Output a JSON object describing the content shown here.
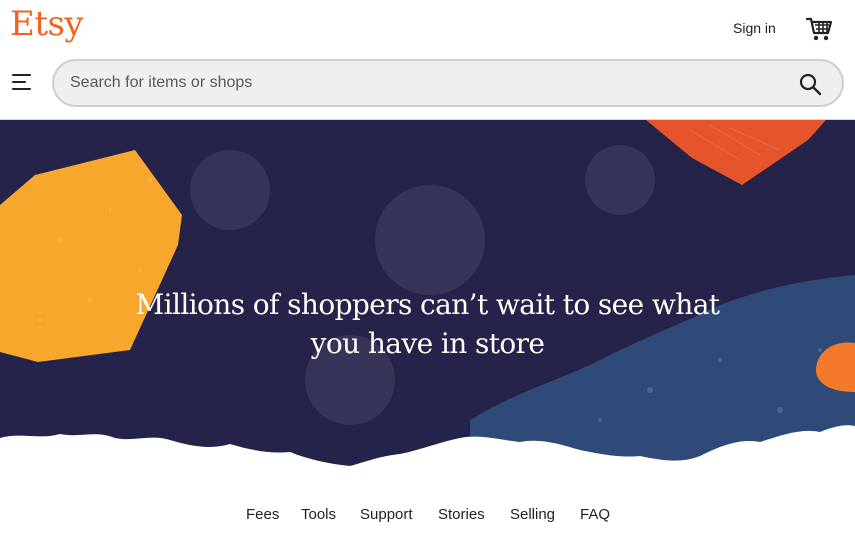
{
  "header": {
    "logo": "Etsy",
    "sign_in": "Sign in",
    "cart_icon": "cart-icon",
    "menu_icon": "hamburger-menu-icon"
  },
  "search": {
    "placeholder": "Search for items or shops",
    "icon": "search-icon"
  },
  "hero": {
    "headline_line1": "Millions of shoppers can’t wait to see what",
    "headline_line2": "you have in store",
    "colors": {
      "background": "#25234a",
      "blue_shape": "#2f4a78",
      "orange_shape": "#f7a72b",
      "red_shape": "#e5542a"
    }
  },
  "footer": {
    "links": [
      "Fees",
      "Tools",
      "Support",
      "Stories",
      "Selling",
      "FAQ"
    ]
  },
  "colors": {
    "brand": "#f1641e",
    "text": "#222222"
  }
}
